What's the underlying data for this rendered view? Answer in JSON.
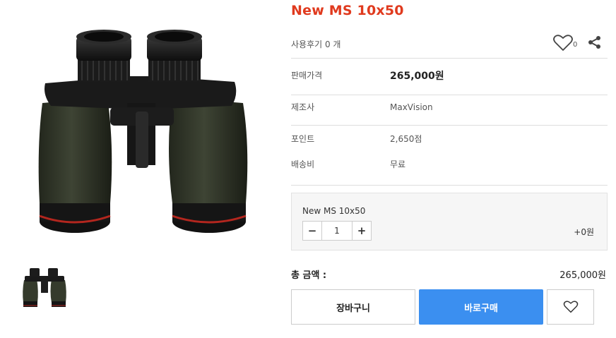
{
  "product": {
    "title": "New MS 10x50",
    "review_text": "사용후기 0 개",
    "wish_count": "0",
    "specs": [
      {
        "label": "판매가격",
        "value": "265,000원"
      },
      {
        "label": "제조사",
        "value": "MaxVision"
      },
      {
        "label": "포인트",
        "value": "2,650점"
      },
      {
        "label": "배송비",
        "value": "무료"
      }
    ]
  },
  "option": {
    "name": "New MS 10x50",
    "qty_minus": "−",
    "qty_value": "1",
    "qty_plus": "+",
    "price": "+0원"
  },
  "total": {
    "label": "총 금액 :",
    "value": "265,000원"
  },
  "buttons": {
    "cart": "장바구니",
    "buy": "바로구매"
  },
  "icons": {
    "heart": "heart-outline-icon",
    "share": "share-icon",
    "wishlist": "heart-outline-icon"
  },
  "colors": {
    "title": "#e03a1e",
    "buy_button": "#3b8ff0"
  }
}
